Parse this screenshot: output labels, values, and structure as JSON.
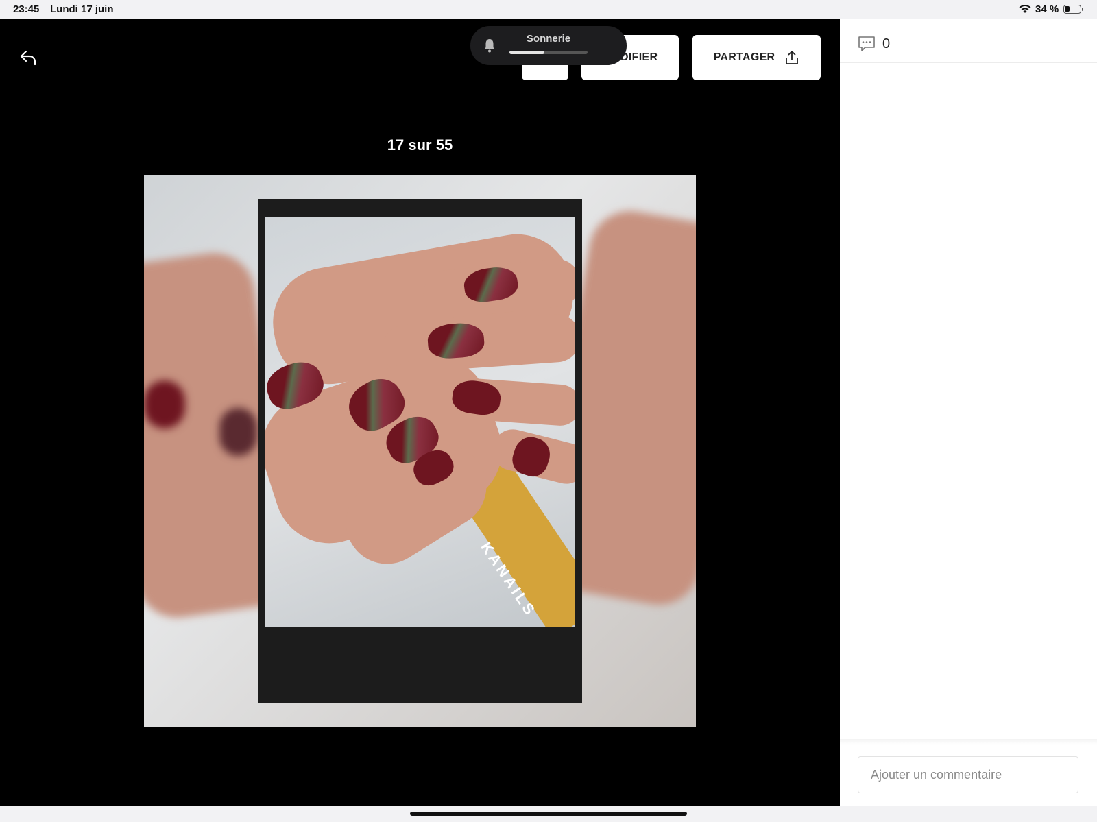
{
  "status_bar": {
    "time": "23:45",
    "date": "Lundi 17 juin",
    "battery": "34 %",
    "battery_level": 0.34,
    "icons": [
      "wifi-icon",
      "battery-icon"
    ]
  },
  "volume_hud": {
    "label": "Sonnerie",
    "level": 0.45,
    "icon": "bell-icon"
  },
  "toolbar": {
    "back_icon": "back-arrow-icon",
    "delete_icon": "trash-icon",
    "modify_label": "MODIFIER",
    "share_label": "PARTAGER",
    "share_icon": "share-icon"
  },
  "viewer": {
    "counter": "17 sur 55",
    "photo_brand_text": "KANAILS"
  },
  "comments": {
    "icon": "comment-icon",
    "count": "0",
    "input_placeholder": "Ajouter un commentaire"
  },
  "colors": {
    "delete_accent": "#d0021b",
    "viewer_bg": "#000000",
    "nail_polish": "#6e1520"
  }
}
